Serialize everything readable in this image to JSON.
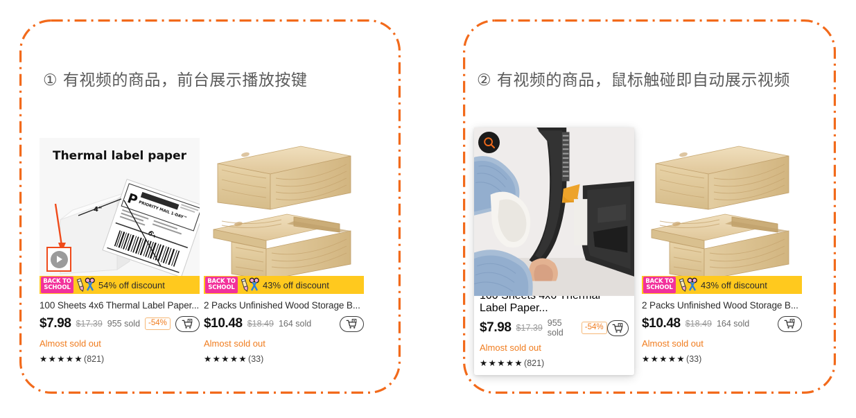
{
  "theme": {
    "accent_orange": "#F26A1B",
    "promo_yellow": "#FFC91E",
    "badge_pink": "#F2319B",
    "highlight_red": "#EF4A1A",
    "text_dark": "#2B2B2B"
  },
  "panels": [
    {
      "id": "panel-play-button",
      "title": "① 有视频的商品，前台展示播放按键",
      "annotation": {
        "play_button_label": "play-button",
        "arrow": "red-arrow-pointing-to-play-button"
      }
    },
    {
      "id": "panel-hover-autoplay",
      "title": "② 有视频的商品，鼠标触碰即自动展示视频",
      "annotation": {
        "search_icon_label": "search-icon"
      }
    }
  ],
  "products": {
    "thermal": {
      "image_heading": "Thermal label paper",
      "image_dims": {
        "width_label": "4\"",
        "height_label": "6\""
      },
      "label_text": "PRIORITY MAIL 1-DAY™",
      "promo_badge": "BACK TO\nSCHOOL",
      "promo_badge_line1": "BACK TO",
      "promo_badge_line2": "SCHOOL",
      "promo_text": "54% off discount",
      "title": "100 Sheets 4x6 Thermal Label Paper...",
      "price": "$7.98",
      "was_price": "$17.39",
      "sold": "955 sold",
      "discount": "-54%",
      "stock": "Almost sold out",
      "stars": "★★★★★",
      "reviews": "(821)"
    },
    "woodbox": {
      "promo_badge_line1": "BACK TO",
      "promo_badge_line2": "SCHOOL",
      "promo_text": "43% off discount",
      "title": "2 Packs Unfinished Wood Storage B...",
      "price": "$10.48",
      "was_price": "$18.49",
      "sold": "164 sold",
      "discount": "",
      "stock": "Almost sold out",
      "stars": "★★★★★",
      "reviews": "(33)"
    }
  }
}
